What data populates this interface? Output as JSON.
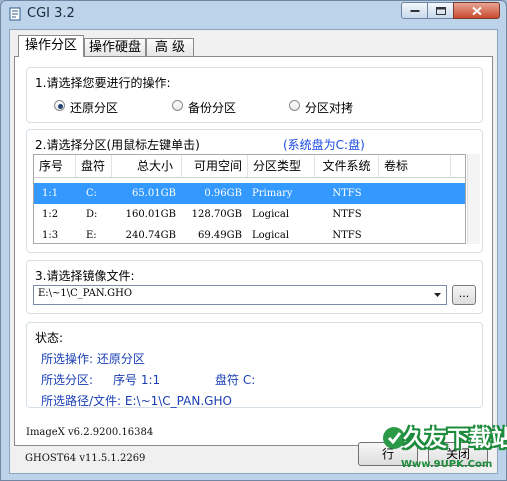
{
  "window": {
    "title": "CGI 3.2"
  },
  "tabs": [
    {
      "label": "操作分区",
      "active": true
    },
    {
      "label": "操作硬盘",
      "active": false
    },
    {
      "label": "高 级",
      "active": false
    }
  ],
  "operation": {
    "label": "1.请选择您要进行的操作:",
    "options": [
      {
        "label": "还原分区",
        "selected": true
      },
      {
        "label": "备份分区",
        "selected": false
      },
      {
        "label": "分区对拷",
        "selected": false
      }
    ]
  },
  "partition": {
    "label": "2.请选择分区(用鼠标左键单击)",
    "system_disk": "(系统盘为C:盘)",
    "columns": [
      "序号",
      "盘符",
      "总大小",
      "可用空间",
      "分区类型",
      "文件系统",
      "卷标"
    ],
    "rows": [
      [
        "1:1",
        "C:",
        "65.01GB",
        "0.96GB",
        "Primary",
        "NTFS",
        ""
      ],
      [
        "1:2",
        "D:",
        "160.01GB",
        "128.70GB",
        "Logical",
        "NTFS",
        ""
      ],
      [
        "1:3",
        "E:",
        "240.74GB",
        "69.49GB",
        "Logical",
        "NTFS",
        ""
      ]
    ],
    "selected_row": 0
  },
  "image_file": {
    "label": "3.请选择镜像文件:",
    "value": "E:\\~1\\C_PAN.GHO",
    "browse_label": "..."
  },
  "status": {
    "label": "状态:",
    "operation_line": "所选操作: 还原分区",
    "partition_prefix": "所选分区:",
    "partition_id": "序号 1:1",
    "drive": "盘符 C:",
    "path_line": "所选路径/文件: E:\\~1\\C_PAN.GHO"
  },
  "footer": {
    "imagex": "ImageX v6.2.9200.16384",
    "ghost": "GHOST64 v11.5.1.2269",
    "execute_label": "行",
    "close_label": "关闭"
  },
  "watermark": {
    "title": "久友下载站",
    "url": "Www.9UPK.Com"
  },
  "colors": {
    "selection": "#3399ff",
    "status_text": "#1a3fb5",
    "system_disk_text": "#1a4be0"
  }
}
